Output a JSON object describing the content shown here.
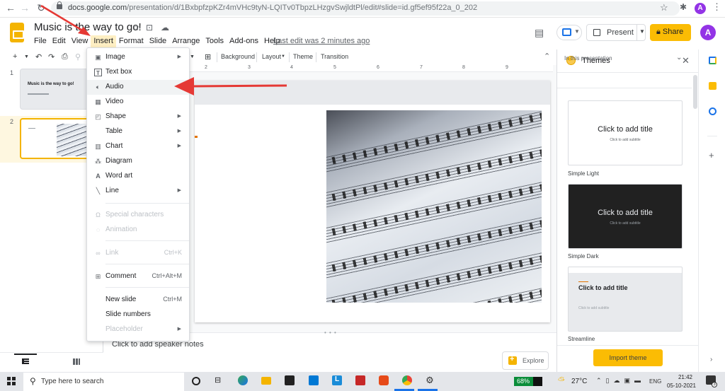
{
  "browser": {
    "url_host": "docs.google.com",
    "url_path": "/presentation/d/1BxbpfzpKZr4mVHc9tyN-LQITv0TbpzLHzgvSwjldtPl/edit#slide=id.gf5ef95f22a_0_202",
    "profile_initial": "A"
  },
  "app": {
    "doc_title": "Music is the way to go!",
    "menu": [
      "File",
      "Edit",
      "View",
      "Insert",
      "Format",
      "Slide",
      "Arrange",
      "Tools",
      "Add-ons",
      "Help"
    ],
    "active_menu": "Insert",
    "last_edit": "Last edit was 2 minutes ago",
    "present_label": "Present",
    "share_label": "Share",
    "profile_initial": "A"
  },
  "toolbar": {
    "background": "Background",
    "layout": "Layout",
    "theme": "Theme",
    "transition": "Transition"
  },
  "ruler": [
    "2",
    "3",
    "4",
    "5",
    "6",
    "7",
    "8",
    "9"
  ],
  "filmstrip": {
    "slides": [
      {
        "number": "1",
        "title": "Music is the way to go!"
      },
      {
        "number": "2",
        "title": ""
      }
    ],
    "selected": 2
  },
  "insert_menu": {
    "items": [
      {
        "label": "Image",
        "icon": "image-icon",
        "submenu": true
      },
      {
        "label": "Text box",
        "icon": "text-box-icon"
      },
      {
        "label": "Audio",
        "icon": "audio-icon",
        "highlighted": true
      },
      {
        "label": "Video",
        "icon": "video-icon"
      },
      {
        "label": "Shape",
        "icon": "shape-icon",
        "submenu": true
      },
      {
        "label": "Table",
        "submenu": true
      },
      {
        "label": "Chart",
        "icon": "chart-icon",
        "submenu": true
      },
      {
        "label": "Diagram",
        "icon": "diagram-icon"
      },
      {
        "label": "Word art",
        "icon": "word-art-icon"
      },
      {
        "label": "Line",
        "icon": "line-icon",
        "submenu": true
      },
      {
        "label": "Special characters",
        "icon": "omega-icon",
        "disabled": true
      },
      {
        "label": "Animation",
        "icon": "animation-icon",
        "disabled": true
      },
      {
        "label": "Link",
        "icon": "link-icon",
        "shortcut": "Ctrl+K",
        "disabled": true
      },
      {
        "label": "Comment",
        "icon": "comment-icon",
        "shortcut": "Ctrl+Alt+M"
      },
      {
        "label": "New slide",
        "shortcut": "Ctrl+M"
      },
      {
        "label": "Slide numbers"
      },
      {
        "label": "Placeholder",
        "submenu": true,
        "disabled": true
      }
    ]
  },
  "editor": {
    "speaker_notes_placeholder": "Click to add speaker notes",
    "explore_label": "Explore"
  },
  "themes_panel": {
    "title": "Themes",
    "filter": "In this presentation",
    "themes": [
      {
        "name": "Simple Light",
        "title": "Click to add title",
        "subtitle": "Click to add subtitle"
      },
      {
        "name": "Simple Dark",
        "title": "Click to add title",
        "subtitle": "Click to add subtitle"
      },
      {
        "name": "Streamline",
        "title": "Click to add title",
        "subtitle": "Click to add subtitle"
      }
    ],
    "import_label": "Import theme"
  },
  "taskbar": {
    "search_placeholder": "Type here to search",
    "battery": "68%",
    "battery_level": 0.68,
    "temperature": "27°C",
    "language": "ENG",
    "time": "21:42",
    "date": "05-10-2021",
    "notifications": "3"
  },
  "colors": {
    "accent_yellow": "#fbbc04",
    "menu_active": "#feefc3",
    "annotation_arrow": "#e53935"
  }
}
